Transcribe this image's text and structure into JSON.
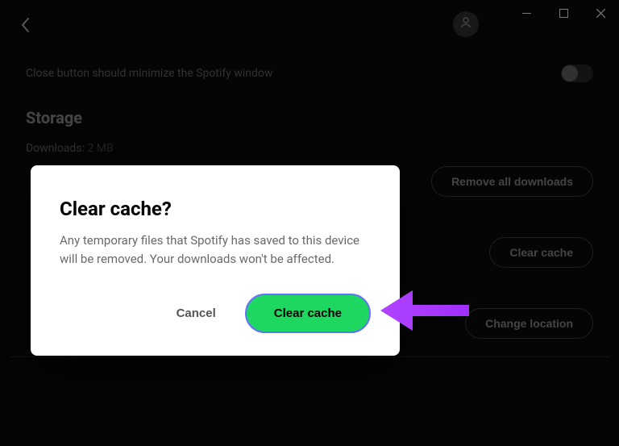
{
  "settings": {
    "close_minimize_label": "Close button should minimize the Spotify window",
    "storage_section_title": "Storage",
    "downloads_label": "Downloads:",
    "downloads_value": "2 MB",
    "remove_downloads_label": "Remove all downloads",
    "clear_cache_label": "Clear cache",
    "change_location_label": "Change location"
  },
  "modal": {
    "title": "Clear cache?",
    "body": "Any temporary files that Spotify has saved to this device will be removed. Your downloads won't be affected.",
    "cancel_label": "Cancel",
    "confirm_label": "Clear cache"
  },
  "colors": {
    "accent_green": "#1ed760",
    "arrow_purple": "#b043ff"
  }
}
